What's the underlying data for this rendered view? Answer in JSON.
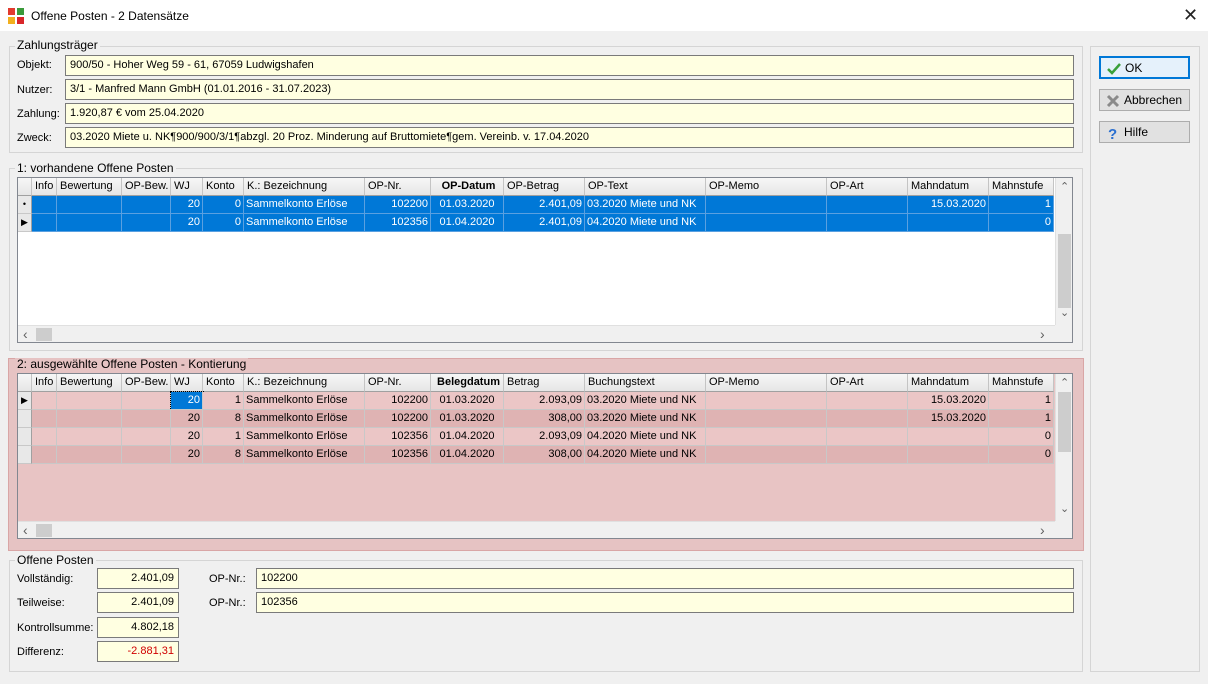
{
  "window": {
    "title": "Offene Posten - 2 Datensätze",
    "close": "✕"
  },
  "zahlungstraeger": {
    "title": "Zahlungsträger",
    "objekt_label": "Objekt:",
    "objekt_value": "900/50 - Hoher Weg 59 - 61, 67059 Ludwigshafen",
    "nutzer_label": "Nutzer:",
    "nutzer_value": "3/1 - Manfred Mann GmbH  (01.01.2016 - 31.07.2023)",
    "zahlung_label": "Zahlung:",
    "zahlung_value": "1.920,87 € vom 25.04.2020",
    "zweck_label": "Zweck:",
    "zweck_value": "03.2020 Miete u. NK¶900/900/3/1¶abzgl. 20 Proz. Minderung auf Bruttomiete¶gem. Vereinb. v. 17.04.2020"
  },
  "buttons": {
    "ok": "OK",
    "abbrechen": "Abbrechen",
    "hilfe": "Hilfe"
  },
  "grid1": {
    "title": "1: vorhandene Offene Posten",
    "columns": [
      "Info",
      "Bewertung",
      "OP-Bew.",
      "WJ",
      "Konto",
      "K.: Bezeichnung",
      "OP-Nr.",
      "OP-Datum",
      "OP-Betrag",
      "OP-Text",
      "OP-Memo",
      "OP-Art",
      "Mahndatum",
      "Mahnstufe"
    ],
    "sorted_column": "OP-Datum",
    "rows": [
      {
        "marker": "•",
        "wj": "20",
        "konto": "0",
        "bez": "Sammelkonto Erlöse",
        "opnr": "102200",
        "datum": "01.03.2020",
        "betrag": "2.401,09",
        "text": "03.2020 Miete und NK",
        "mahndatum": "15.03.2020",
        "mahnstufe": "1"
      },
      {
        "marker": "▶",
        "wj": "20",
        "konto": "0",
        "bez": "Sammelkonto Erlöse",
        "opnr": "102356",
        "datum": "01.04.2020",
        "betrag": "2.401,09",
        "text": "04.2020 Miete und NK",
        "mahndatum": "",
        "mahnstufe": "0"
      }
    ]
  },
  "grid2": {
    "title": "2: ausgewählte Offene Posten - Kontierung",
    "columns": [
      "Info",
      "Bewertung",
      "OP-Bew.",
      "WJ",
      "Konto",
      "K.: Bezeichnung",
      "OP-Nr.",
      "Belegdatum",
      "Betrag",
      "Buchungstext",
      "OP-Memo",
      "OP-Art",
      "Mahndatum",
      "Mahnstufe"
    ],
    "sorted_column": "Belegdatum",
    "rows": [
      {
        "marker": "▶",
        "wj": "20",
        "konto": "1",
        "bez": "Sammelkonto Erlöse",
        "opnr": "102200",
        "datum": "01.03.2020",
        "betrag": "2.093,09",
        "text": "03.2020 Miete und NK",
        "mahndatum": "15.03.2020",
        "mahnstufe": "1"
      },
      {
        "marker": "",
        "wj": "20",
        "konto": "8",
        "bez": "Sammelkonto Erlöse",
        "opnr": "102200",
        "datum": "01.03.2020",
        "betrag": "308,00",
        "text": "03.2020 Miete und NK",
        "mahndatum": "15.03.2020",
        "mahnstufe": "1"
      },
      {
        "marker": "",
        "wj": "20",
        "konto": "1",
        "bez": "Sammelkonto Erlöse",
        "opnr": "102356",
        "datum": "01.04.2020",
        "betrag": "2.093,09",
        "text": "04.2020 Miete und NK",
        "mahndatum": "",
        "mahnstufe": "0"
      },
      {
        "marker": "",
        "wj": "20",
        "konto": "8",
        "bez": "Sammelkonto Erlöse",
        "opnr": "102356",
        "datum": "01.04.2020",
        "betrag": "308,00",
        "text": "04.2020 Miete und NK",
        "mahndatum": "",
        "mahnstufe": "0"
      }
    ]
  },
  "offene_posten": {
    "title": "Offene Posten",
    "vollstaendig_label": "Vollständig:",
    "vollstaendig_value": "2.401,09",
    "teilweise_label": "Teilweise:",
    "teilweise_value": "2.401,09",
    "kontrollsumme_label": "Kontrollsumme:",
    "kontrollsumme_value": "4.802,18",
    "differenz_label": "Differenz:",
    "differenz_value": "-2.881,31",
    "opnr1_label": "OP-Nr.:",
    "opnr1_value": "102200",
    "opnr2_label": "OP-Nr.:",
    "opnr2_value": "102356"
  },
  "colors": {
    "selection": "#0078d7",
    "field_bg": "#ffffe1",
    "highlight_frame": "#e6c3c3",
    "negative": "#d00000"
  }
}
